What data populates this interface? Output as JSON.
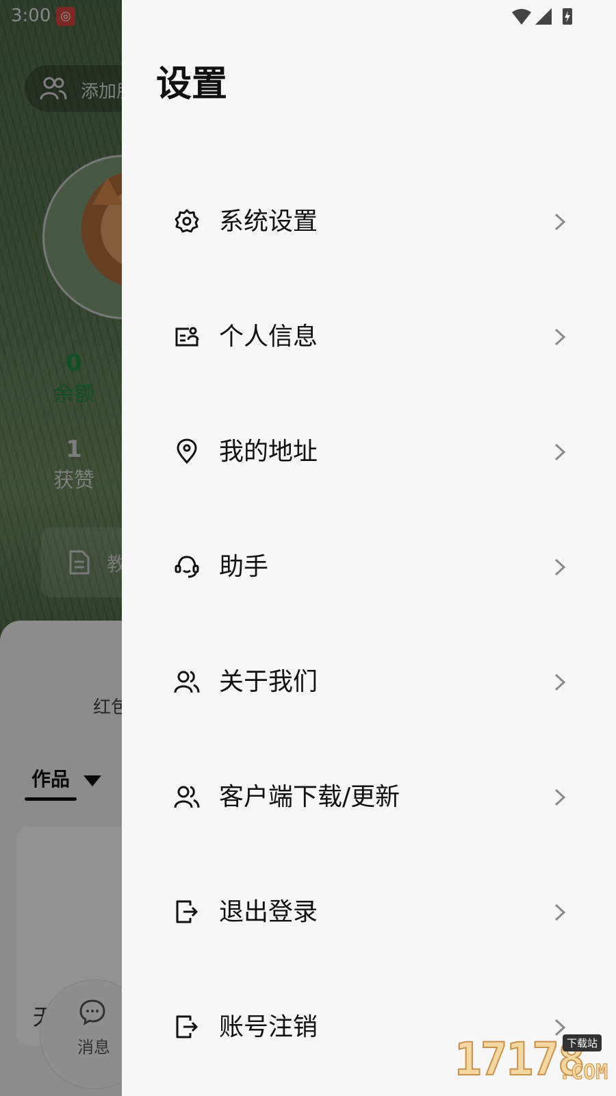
{
  "status_bar": {
    "time": "3:00"
  },
  "background": {
    "add_friend_label": "添加朋",
    "balance": {
      "value": "0",
      "label": "余额"
    },
    "likes": {
      "value": "1",
      "label": "获赞"
    },
    "tutorial_label": "教",
    "red_packet_label": "红包",
    "works_tab_label": "作品",
    "message_label": "消息",
    "bottom_left_char": "无"
  },
  "drawer": {
    "title": "设置",
    "items": [
      {
        "label": "系统设置",
        "icon": "gear-icon"
      },
      {
        "label": "个人信息",
        "icon": "id-card-icon"
      },
      {
        "label": "我的地址",
        "icon": "location-pin-icon"
      },
      {
        "label": "助手",
        "icon": "headset-icon"
      },
      {
        "label": "关于我们",
        "icon": "users-icon"
      },
      {
        "label": "客户端下载/更新",
        "icon": "users-icon"
      },
      {
        "label": "退出登录",
        "icon": "logout-icon"
      },
      {
        "label": "账号注销",
        "icon": "logout-icon"
      }
    ]
  },
  "watermark": {
    "digits": "17178",
    "tag": "下载站",
    "domain": ".COM"
  },
  "colors": {
    "accent_green": "#1f8a43",
    "drawer_bg": "#f7f7f7",
    "text_primary": "#111111"
  }
}
